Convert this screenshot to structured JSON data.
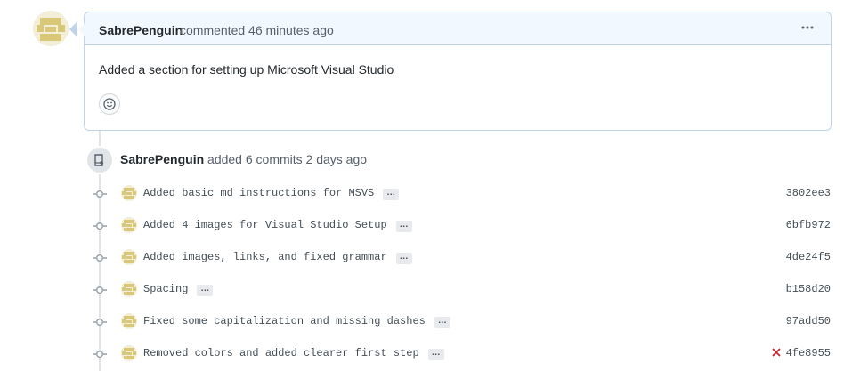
{
  "comment": {
    "author": "SabrePenguin",
    "action": "commented 46 minutes ago",
    "body": "Added a section for setting up Microsoft Visual Studio",
    "menu_icon": "kebab-horizontal-icon",
    "reaction_icon": "smiley-icon"
  },
  "push": {
    "icon": "repo-push-icon",
    "author": "SabrePenguin",
    "action": "added 6 commits",
    "time": "2 days ago"
  },
  "commits": [
    {
      "message": "Added basic md instructions for MSVS",
      "sha": "3802ee3",
      "status": ""
    },
    {
      "message": "Added 4 images for Visual Studio Setup",
      "sha": "6bfb972",
      "status": ""
    },
    {
      "message": "Added images, links, and fixed grammar",
      "sha": "4de24f5",
      "status": ""
    },
    {
      "message": "Spacing",
      "sha": "b158d20",
      "status": ""
    },
    {
      "message": "Fixed some capitalization and missing dashes",
      "sha": "97add50",
      "status": ""
    },
    {
      "message": "Removed colors and added clearer first step",
      "sha": "4fe8955",
      "status": "failure"
    }
  ],
  "ellipsis_label": "…",
  "colors": {
    "header_bg": "#f1f8ff",
    "header_border": "#c0d3eb",
    "failure": "#cb2431",
    "avatar": "#d8c878"
  }
}
